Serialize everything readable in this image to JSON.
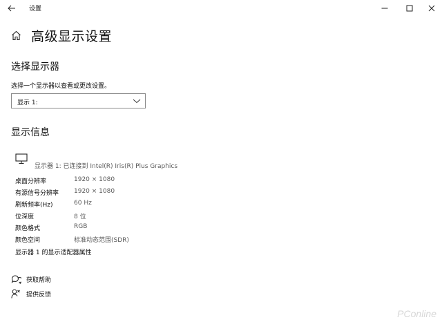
{
  "window": {
    "title": "设置"
  },
  "page": {
    "title": "高级显示设置"
  },
  "select_display": {
    "heading": "选择显示器",
    "label": "选择一个显示器以查看或更改设置。",
    "selected": "显示 1:"
  },
  "display_info": {
    "heading": "显示信息",
    "monitor_line": "显示器 1: 已连接到 Intel(R) Iris(R) Plus Graphics",
    "rows": [
      {
        "label": "桌面分辨率",
        "value": "1920 × 1080"
      },
      {
        "label": "有源信号分辨率",
        "value": "1920 × 1080"
      },
      {
        "label": "刷新频率(Hz)",
        "value": "60 Hz"
      },
      {
        "label": "位深度",
        "value": "8 位"
      },
      {
        "label": "颜色格式",
        "value": "RGB"
      },
      {
        "label": "颜色空间",
        "value": "标准动态范围(SDR)"
      }
    ],
    "adapter_link": "显示器 1 的显示适配器属性"
  },
  "help": {
    "get_help": "获取帮助",
    "feedback": "提供反馈"
  },
  "watermark": "PConline",
  "icons": {
    "back": "back-arrow-icon",
    "minimize": "minimize-icon",
    "maximize": "maximize-icon",
    "close": "close-icon",
    "home": "home-icon",
    "chevron": "chevron-down-icon",
    "monitor": "monitor-icon",
    "help": "chat-help-icon",
    "feedback": "person-feedback-icon"
  }
}
